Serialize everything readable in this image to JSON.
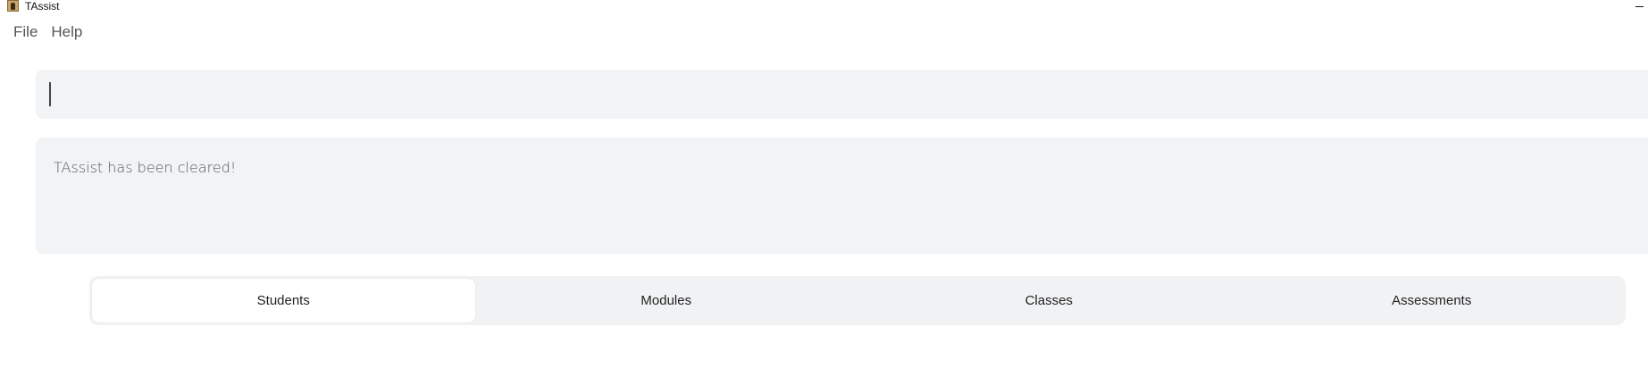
{
  "window": {
    "title": "TAssist",
    "icon": "app-icon"
  },
  "menu": {
    "items": [
      {
        "label": "File"
      },
      {
        "label": "Help"
      }
    ]
  },
  "command": {
    "value": "",
    "placeholder": ""
  },
  "result": {
    "message": "TAssist has been cleared!"
  },
  "tabs": [
    {
      "label": "Students",
      "active": true
    },
    {
      "label": "Modules",
      "active": false
    },
    {
      "label": "Classes",
      "active": false
    },
    {
      "label": "Assessments",
      "active": false
    }
  ]
}
